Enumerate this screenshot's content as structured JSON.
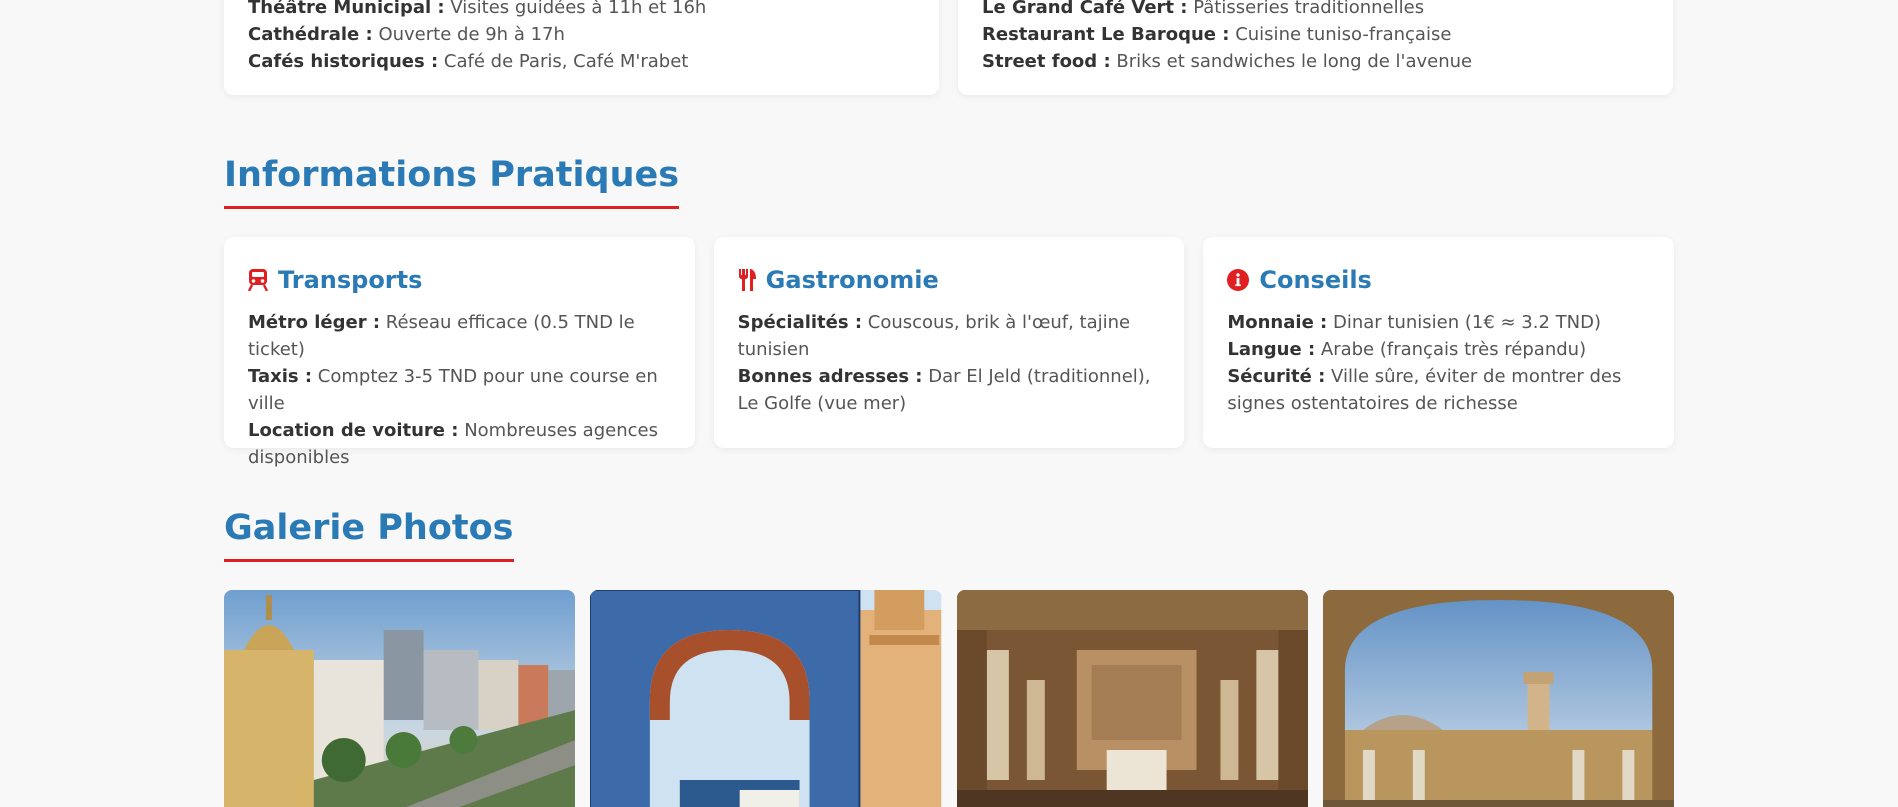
{
  "top_cards": [
    {
      "lines": [
        {
          "label": "Théâtre Municipal :",
          "text": " Visites guidées à 11h et 16h"
        },
        {
          "label": "Cathédrale :",
          "text": " Ouverte de 9h à 17h"
        },
        {
          "label": "Cafés historiques :",
          "text": " Café de Paris, Café M'rabet"
        }
      ]
    },
    {
      "lines": [
        {
          "label": "Le Grand Café Vert :",
          "text": " Pâtisseries traditionnelles"
        },
        {
          "label": "Restaurant Le Baroque :",
          "text": " Cuisine tuniso-française"
        },
        {
          "label": "Street food :",
          "text": " Briks et sandwiches le long de l'avenue"
        }
      ]
    }
  ],
  "sections": {
    "info_title": "Informations Pratiques",
    "gallery_title": "Galerie Photos"
  },
  "info_cards": [
    {
      "icon": "train-icon",
      "title": "Transports",
      "lines": [
        {
          "label": "Métro léger :",
          "text": " Réseau efficace (0.5 TND le ticket)"
        },
        {
          "label": "Taxis :",
          "text": " Comptez 3-5 TND pour une course en ville"
        },
        {
          "label": "Location de voiture :",
          "text": " Nombreuses agences disponibles"
        }
      ]
    },
    {
      "icon": "utensils-icon",
      "title": "Gastronomie",
      "lines": [
        {
          "label": "Spécialités :",
          "text": " Couscous, brik à l'œuf, tajine tunisien"
        },
        {
          "label": "Bonnes adresses :",
          "text": " Dar El Jeld (traditionnel), Le Golfe (vue mer)"
        }
      ]
    },
    {
      "icon": "info-icon",
      "title": "Conseils",
      "lines": [
        {
          "label": "Monnaie :",
          "text": " Dinar tunisien (1€ ≈ 3.2 TND)"
        },
        {
          "label": "Langue :",
          "text": " Arabe (français très répandu)"
        },
        {
          "label": "Sécurité :",
          "text": " Ville sûre, éviter de montrer des signes ostentatoires de richesse"
        }
      ]
    }
  ],
  "gallery": [
    {
      "name": "avenue-bourguiba-photo"
    },
    {
      "name": "tiled-arch-minaret-photo"
    },
    {
      "name": "bardo-museum-hall-photo"
    },
    {
      "name": "zitouna-mosque-courtyard-photo"
    }
  ],
  "colors": {
    "accent_blue": "#2a7ab5",
    "accent_red": "#e02020",
    "background": "#f8f8f8"
  }
}
